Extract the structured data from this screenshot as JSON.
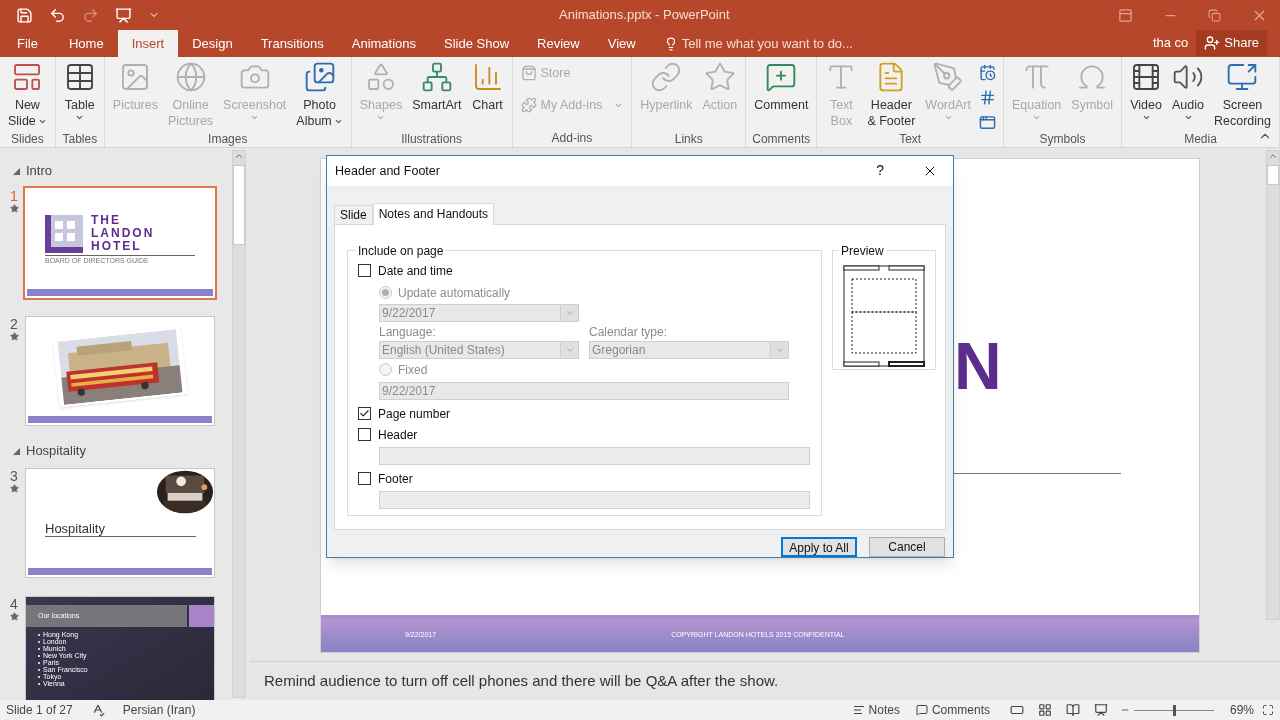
{
  "title_bar": {
    "title": "Animations.pptx - PowerPoint"
  },
  "ribbon_tabs": [
    {
      "label": "File",
      "selected": false
    },
    {
      "label": "Home",
      "selected": false
    },
    {
      "label": "Insert",
      "selected": true
    },
    {
      "label": "Design",
      "selected": false
    },
    {
      "label": "Transitions",
      "selected": false
    },
    {
      "label": "Animations",
      "selected": false
    },
    {
      "label": "Slide Show",
      "selected": false
    },
    {
      "label": "Review",
      "selected": false
    },
    {
      "label": "View",
      "selected": false
    }
  ],
  "tell_me": {
    "placeholder": "Tell me what you want to do..."
  },
  "user": "tha co",
  "share": "Share",
  "ribbon_groups": [
    {
      "label": "Slides",
      "buttons": [
        {
          "kind": "large",
          "lines": [
            "New",
            "Slide"
          ],
          "disabled": false,
          "dropdown": true
        }
      ]
    },
    {
      "label": "Tables",
      "buttons": [
        {
          "kind": "large",
          "lines": [
            "Table"
          ],
          "disabled": false,
          "dropdown": true
        }
      ]
    },
    {
      "label": "Images",
      "buttons": [
        {
          "kind": "large",
          "lines": [
            "Pictures"
          ],
          "disabled": true,
          "dropdown": false
        },
        {
          "kind": "large",
          "lines": [
            "Online",
            "Pictures"
          ],
          "disabled": true,
          "dropdown": false
        },
        {
          "kind": "large",
          "lines": [
            "Screenshot"
          ],
          "disabled": true,
          "dropdown": true
        },
        {
          "kind": "large",
          "lines": [
            "Photo",
            "Album"
          ],
          "disabled": false,
          "dropdown": true
        }
      ]
    },
    {
      "label": "Illustrations",
      "buttons": [
        {
          "kind": "large",
          "lines": [
            "Shapes"
          ],
          "disabled": true,
          "dropdown": true
        },
        {
          "kind": "large",
          "lines": [
            "SmartArt"
          ],
          "disabled": false,
          "dropdown": false
        },
        {
          "kind": "large",
          "lines": [
            "Chart"
          ],
          "disabled": false,
          "dropdown": false
        }
      ]
    },
    {
      "label": "Add-ins",
      "buttons": [
        {
          "kind": "small",
          "lines": [
            "Store"
          ],
          "disabled": true,
          "dropdown": false
        },
        {
          "kind": "small",
          "lines": [
            "My Add-ins"
          ],
          "disabled": true,
          "dropdown": true
        }
      ]
    },
    {
      "label": "Links",
      "buttons": [
        {
          "kind": "large",
          "lines": [
            "Hyperlink"
          ],
          "disabled": true,
          "dropdown": false
        },
        {
          "kind": "large",
          "lines": [
            "Action"
          ],
          "disabled": true,
          "dropdown": false
        }
      ]
    },
    {
      "label": "Comments",
      "buttons": [
        {
          "kind": "large",
          "lines": [
            "Comment"
          ],
          "disabled": false,
          "dropdown": false
        }
      ]
    },
    {
      "label": "Text",
      "buttons": [
        {
          "kind": "large",
          "lines": [
            "Text",
            "Box"
          ],
          "disabled": true,
          "dropdown": false
        },
        {
          "kind": "large",
          "lines": [
            "Header",
            "& Footer"
          ],
          "disabled": false,
          "dropdown": false
        },
        {
          "kind": "large",
          "lines": [
            "WordArt"
          ],
          "disabled": true,
          "dropdown": true
        },
        {
          "kind": "icon",
          "disabled": false
        },
        {
          "kind": "icon",
          "disabled": false
        },
        {
          "kind": "icon",
          "disabled": false
        }
      ]
    },
    {
      "label": "Symbols",
      "buttons": [
        {
          "kind": "large",
          "lines": [
            "Equation"
          ],
          "disabled": true,
          "dropdown": true
        },
        {
          "kind": "large",
          "lines": [
            "Symbol"
          ],
          "disabled": true,
          "dropdown": false
        }
      ]
    },
    {
      "label": "Media",
      "buttons": [
        {
          "kind": "large",
          "lines": [
            "Video"
          ],
          "disabled": false,
          "dropdown": true
        },
        {
          "kind": "large",
          "lines": [
            "Audio"
          ],
          "disabled": false,
          "dropdown": true
        },
        {
          "kind": "large",
          "lines": [
            "Screen",
            "Recording"
          ],
          "disabled": false,
          "dropdown": false
        }
      ]
    }
  ],
  "sections": [
    {
      "title": "Intro",
      "expanded": true,
      "slides": [
        {
          "number": "1",
          "selected": true,
          "kind": "title",
          "title_lines": [
            "THE",
            "LANDON",
            "HOTEL"
          ],
          "subtitle": "BOARD OF DIRECTORS GUIDE"
        },
        {
          "number": "2",
          "selected": false,
          "kind": "picture"
        }
      ]
    },
    {
      "title": "Hospitality",
      "expanded": true,
      "slides": [
        {
          "number": "3",
          "selected": false,
          "kind": "section",
          "title": "Hospitality"
        },
        {
          "number": "4",
          "selected": false,
          "kind": "list",
          "title": "Our locations",
          "items": [
            "Hong Kong",
            "London",
            "Munich",
            "New York City",
            "Paris",
            "San Francisco",
            "Tokyo",
            "Vienna"
          ]
        }
      ]
    }
  ],
  "slide": {
    "title_fragment": "N",
    "footer_date": "9/22/2017",
    "footer_text": "COPYRIGHT LANDON HOTELS 2015 CONFIDENTIAL"
  },
  "notes": "Remind audience to turn off cell phones and there will be Q&A after the show.",
  "dialog": {
    "title": "Header and Footer",
    "help": "?",
    "tabs": [
      {
        "label": "Slide",
        "selected": false
      },
      {
        "label": "Notes and Handouts",
        "selected": true
      }
    ],
    "group_label": "Include on page",
    "date_time": {
      "label": "Date and time",
      "checked": false
    },
    "update_auto": {
      "label": "Update automatically",
      "selected": true
    },
    "date_value": "9/22/2017",
    "language_label": "Language:",
    "language": "English (United States)",
    "calendar_label": "Calendar type:",
    "calendar": "Gregorian",
    "fixed": {
      "label": "Fixed",
      "selected": false
    },
    "fixed_value": "9/22/2017",
    "page_number": {
      "label": "Page number",
      "checked": true
    },
    "header": {
      "label": "Header",
      "checked": false
    },
    "footer": {
      "label": "Footer",
      "checked": false
    },
    "preview_label": "Preview",
    "buttons": [
      {
        "label": "Apply to All",
        "default": true
      },
      {
        "label": "Cancel",
        "default": false
      }
    ]
  },
  "status_bar": {
    "slide": "Slide 1 of 27",
    "language": "Persian (Iran)",
    "notes": "Notes",
    "comments": "Comments",
    "zoom": "69%",
    "zoom_slider": {
      "level": 0.5
    }
  }
}
